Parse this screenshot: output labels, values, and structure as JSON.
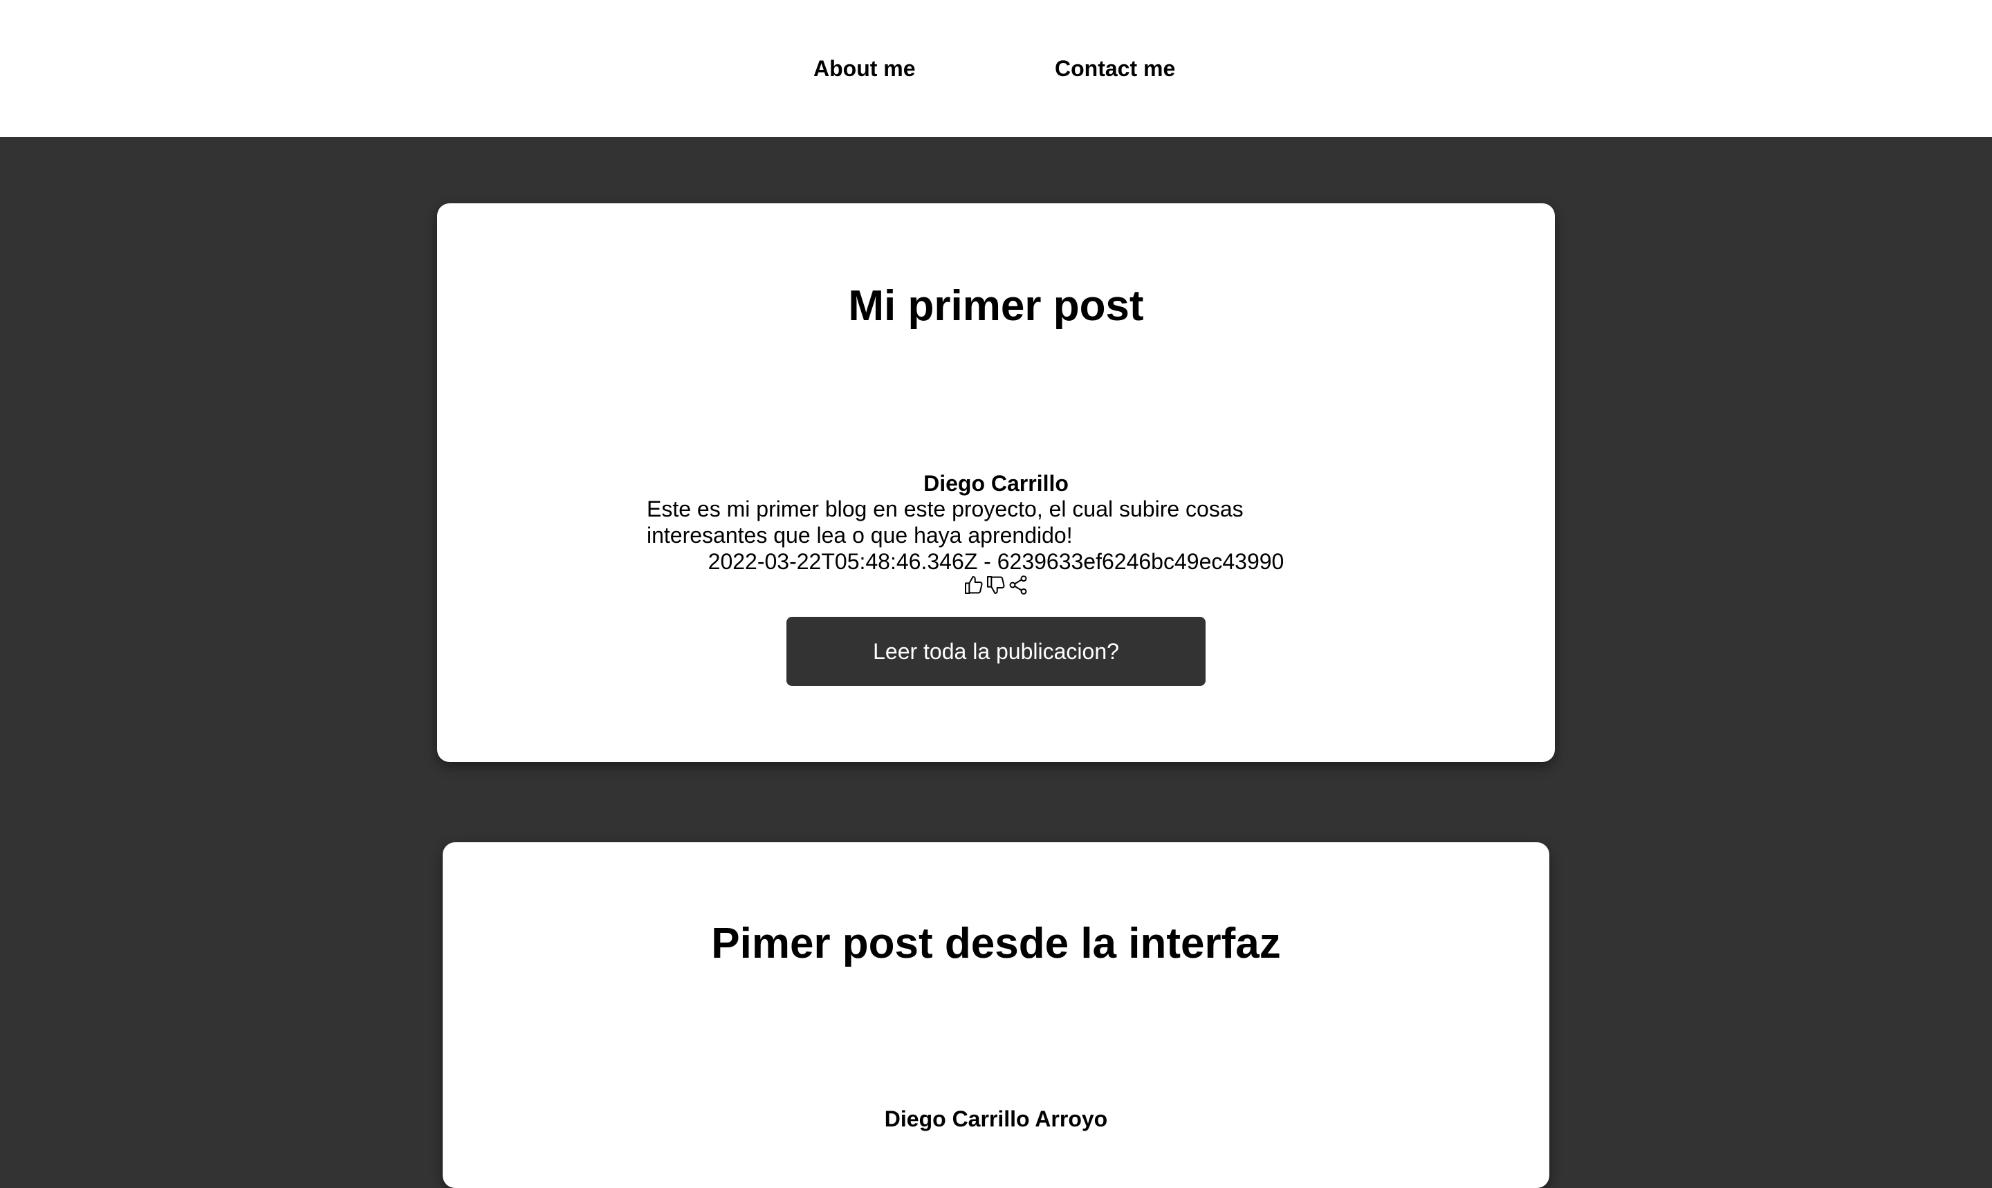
{
  "nav": {
    "about_label": "About me",
    "contact_label": "Contact me"
  },
  "posts": [
    {
      "title": "Mi primer post",
      "author": "Diego Carrillo",
      "excerpt": "Este es mi primer blog en este proyecto, el cual subire cosas interesantes que lea o que haya aprendido!",
      "meta": "2022-03-22T05:48:46.346Z - 6239633ef6246bc49ec43990",
      "actions": [
        "thumbs-up-icon",
        "thumbs-down-icon",
        "share-icon"
      ],
      "read_more_label": "Leer toda la publicacion?"
    },
    {
      "title": "Pimer post desde la interfaz",
      "author": "Diego Carrillo Arroyo"
    }
  ],
  "colors": {
    "page_background": "#333333",
    "card_background": "#ffffff",
    "button_background": "#333333",
    "button_text": "#ffffff"
  }
}
